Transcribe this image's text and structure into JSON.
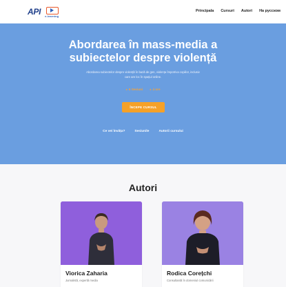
{
  "header": {
    "logo_text": "API",
    "logo_caption": "e-learning",
    "nav": [
      "Principala",
      "Cursuri",
      "Autori",
      "На русском"
    ]
  },
  "hero": {
    "title_line1": "Abordarea în mass-media a",
    "title_line2": "subiectelor despre violență",
    "subtitle_line1": "Abordarea subiectelor despre violență în bază de gen, violența împotriva copiilor, inclusiv",
    "subtitle_line2": "care are loc în spațiul online.",
    "meta": [
      "6 Sesiuni",
      "4 ore"
    ],
    "cta_label": "ÎNCEPE CURSUL",
    "links": [
      "Ce vei învăța?",
      "Sesiunile",
      "Autorii cursului"
    ]
  },
  "authors": {
    "title": "Autori",
    "cards": [
      {
        "name": "Viorica Zaharia",
        "role": "Jurnalistă, expertă media"
      },
      {
        "name": "Rodica Corețchi",
        "role": "Consultantă în domeniul comunicării"
      }
    ]
  },
  "colors": {
    "hero_bg": "#6a9ee0",
    "cta": "#f5a128",
    "author_card_1": "#8f5fdc",
    "author_card_2": "#9a82e3"
  }
}
